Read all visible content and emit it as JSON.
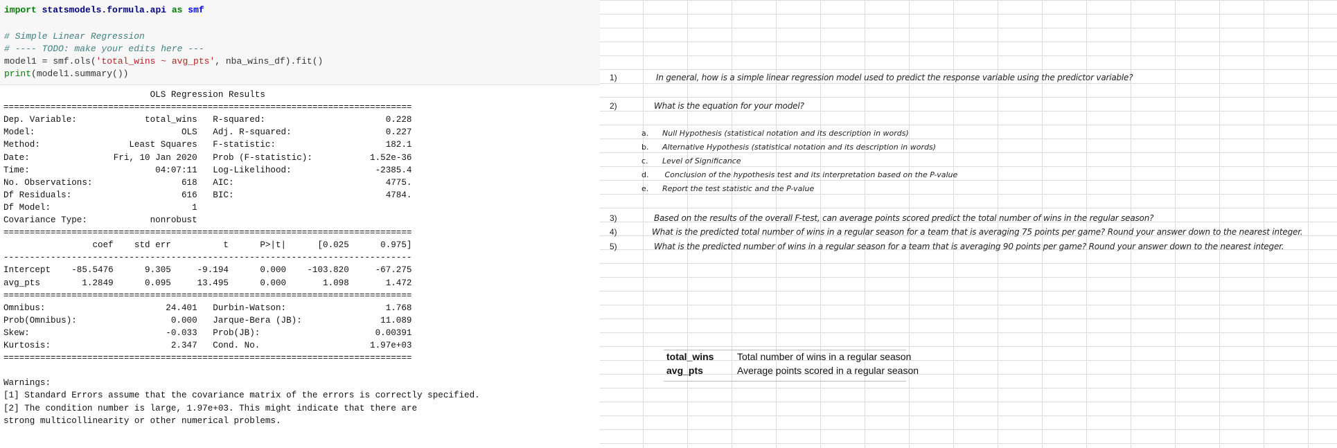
{
  "code": {
    "line1_kw1": "import",
    "line1_mod": " statsmodels.formula.api ",
    "line1_kw2": "as",
    "line1_alias": " smf",
    "line2": "# Simple Linear Regression",
    "line3": "# ---- TODO: make your edits here ---",
    "line4_pre": "model1 = smf.ols(",
    "line4_str": "'total_wins ~ avg_pts'",
    "line4_post": ", nba_wins_df).fit()",
    "line5_fn": "print",
    "line5_rest": "(model1.summary())"
  },
  "output": [
    "                            OLS Regression Results                            ",
    "==============================================================================",
    "Dep. Variable:             total_wins   R-squared:                       0.228",
    "Model:                            OLS   Adj. R-squared:                  0.227",
    "Method:                 Least Squares   F-statistic:                     182.1",
    "Date:                Fri, 10 Jan 2020   Prob (F-statistic):           1.52e-36",
    "Time:                        04:07:11   Log-Likelihood:                -2385.4",
    "No. Observations:                 618   AIC:                             4775.",
    "Df Residuals:                     616   BIC:                             4784.",
    "Df Model:                           1                                         ",
    "Covariance Type:            nonrobust                                         ",
    "==============================================================================",
    "                 coef    std err          t      P>|t|      [0.025      0.975]",
    "------------------------------------------------------------------------------",
    "Intercept    -85.5476      9.305     -9.194      0.000    -103.820     -67.275",
    "avg_pts        1.2849      0.095     13.495      0.000       1.098       1.472",
    "==============================================================================",
    "Omnibus:                       24.401   Durbin-Watson:                   1.768",
    "Prob(Omnibus):                  0.000   Jarque-Bera (JB):               11.089",
    "Skew:                          -0.033   Prob(JB):                      0.00391",
    "Kurtosis:                       2.347   Cond. No.                     1.97e+03",
    "==============================================================================",
    "",
    "Warnings:",
    "[1] Standard Errors assume that the covariance matrix of the errors is correctly specified.",
    "[2] The condition number is large, 1.97e+03. This might indicate that there are",
    "strong multicollinearity or other numerical problems."
  ],
  "sheet": {
    "q1_num": "1)",
    "q1": "In general, how is a simple linear regression model used to predict the response variable using the predictor variable?",
    "q2_num": "2)",
    "q2": "What is the equation for your model?",
    "sub": [
      {
        "label": "a.",
        "text": "Null Hypothesis (statistical notation and its description in words)"
      },
      {
        "label": "b.",
        "text": "Alternative Hypothesis (statistical notation and its description in words)"
      },
      {
        "label": "c.",
        "text": "Level of Significance"
      },
      {
        "label": "d.",
        "text": " Conclusion of the hypothesis test and its interpretation based on the P-value"
      },
      {
        "label": "e.",
        "text": "Report the test statistic and the P-value"
      }
    ],
    "q3_num": "3)",
    "q3": "Based on the results of the overall F-test, can average points scored predict the total number of wins in the regular season?",
    "q4_num": "4)",
    "q4": "What is the predicted total number of wins in a regular season for a team that is averaging 75 points per game? Round your answer down to the nearest integer.",
    "q5_num": "5)",
    "q5": "What is the predicted number of wins in a regular season for a team that is averaging 90 points per game? Round your answer down to the nearest integer.",
    "defs": [
      {
        "name": "total_wins",
        "desc": "Total number of wins in a regular season"
      },
      {
        "name": "avg_pts",
        "desc": "Average points scored in a regular season"
      }
    ]
  }
}
